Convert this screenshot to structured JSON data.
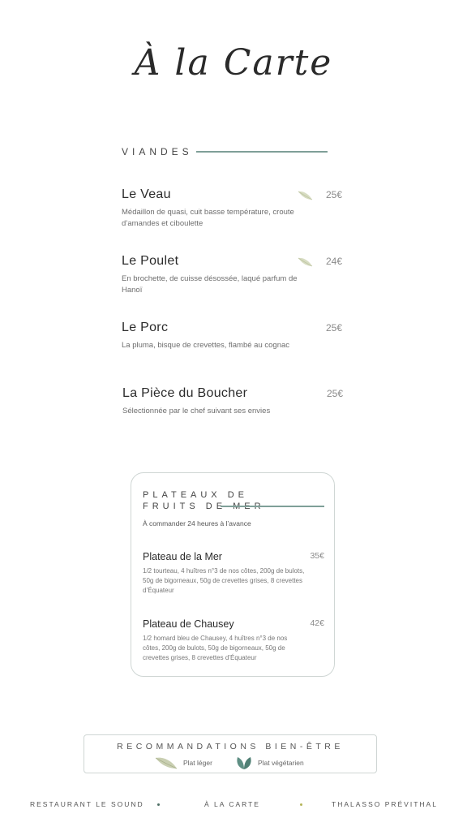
{
  "title": "À la Carte",
  "section": {
    "label": "VIANDES",
    "accent": "#7f9f98"
  },
  "dishes": [
    {
      "name": "Le Veau",
      "desc": "Médaillon de quasi, cuit basse température, croute d’amandes et ciboulette",
      "price": "25€",
      "icon": "leaf-light-icon"
    },
    {
      "name": "Le Poulet",
      "desc": "En brochette, de cuisse désossée, laqué parfum de Hanoï",
      "price": "24€",
      "icon": "leaf-light-icon"
    },
    {
      "name": "Le Porc",
      "desc": "La pluma, bisque de crevettes, flambé au cognac",
      "price": "25€"
    },
    {
      "name": "La Pièce du Boucher",
      "desc": "Sélectionnée par le chef suivant ses envies",
      "price": "25€"
    }
  ],
  "plateaux": {
    "title_line1": "PLATEAUX DE",
    "title_line2": "FRUITS DE MER",
    "note": "À commander 24 heures à l’avance",
    "items": [
      {
        "name": "Plateau de la Mer",
        "desc": "1/2 tourteau, 4 huîtres n°3 de nos côtes, 200g de bulots, 50g de bigorneaux, 50g de crevettes grises, 8 crevettes d’Équateur",
        "price": "35€"
      },
      {
        "name": "Plateau de Chausey",
        "desc": "1/2 homard bleu de Chausey, 4 huîtres n°3 de nos côtes, 200g de bulots, 50g de bigorneaux, 50g de crevettes grises, 8 crevettes d’Équateur",
        "price": "42€"
      }
    ]
  },
  "recommandations": {
    "title": "RECOMMANDATIONS BIEN-ÊTRE",
    "light_label": "Plat léger",
    "veg_label": "Plat végétarien",
    "light_color": "#c9cfb2",
    "veg_color": "#5f8f84"
  },
  "footer": {
    "left": "RESTAURANT LE SOUND",
    "center": "À LA CARTE",
    "right": "THALASSO PRÉVITHAL",
    "dot1_color": "#4f6f66",
    "dot2_color": "#b5b55a"
  }
}
